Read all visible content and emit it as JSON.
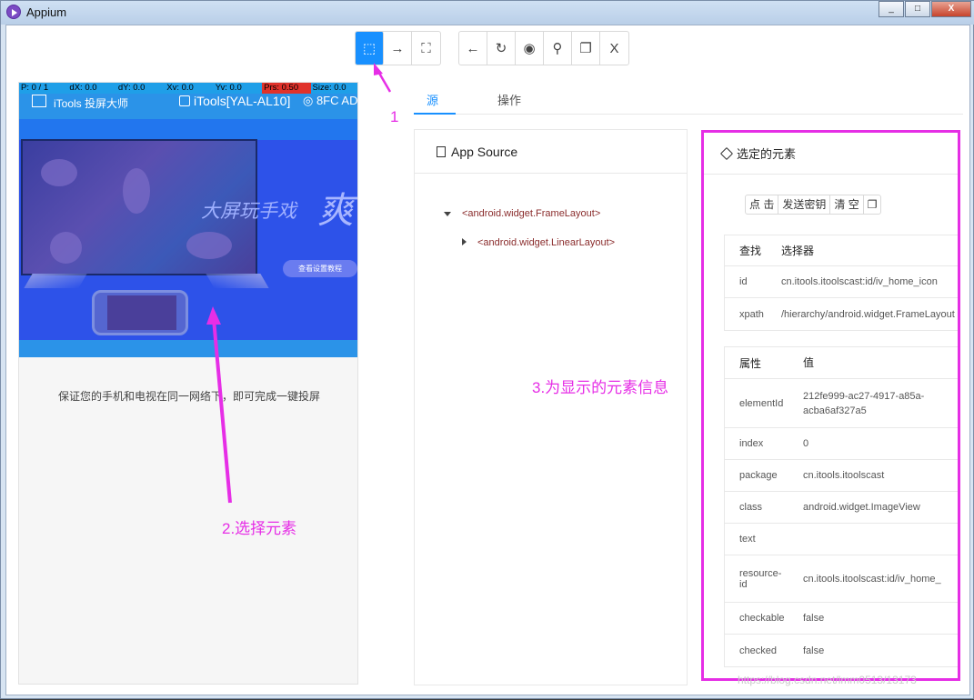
{
  "window": {
    "title": "Appium",
    "controls": [
      "_",
      "□",
      "X"
    ]
  },
  "toolbar": {
    "group1": [
      {
        "icon": "select-element-icon",
        "glyph": "⬚",
        "active": true
      },
      {
        "icon": "swipe-icon",
        "glyph": "→",
        "active": false
      },
      {
        "icon": "tap-coordinates-icon",
        "glyph": "⛶",
        "active": false
      }
    ],
    "group2": [
      {
        "icon": "back-icon",
        "glyph": "←"
      },
      {
        "icon": "refresh-icon",
        "glyph": "↻"
      },
      {
        "icon": "eye-icon",
        "glyph": "◉"
      },
      {
        "icon": "search-icon",
        "glyph": "⚲"
      },
      {
        "icon": "copy-icon",
        "glyph": "❐"
      },
      {
        "icon": "close-icon",
        "glyph": "X"
      }
    ]
  },
  "device": {
    "overlay": [
      "P: 0 / 1",
      "dX: 0.0",
      "dY: 0.0",
      "Xv: 0.0",
      "Yv: 0.0",
      "Prs: 0.50",
      "Size: 0.0"
    ],
    "header_left": "iTools 投屏大师",
    "header_right": "iTools[YAL-AL10]",
    "header_extra": "◎ 8FC AD",
    "slogan": "大屏玩手戏",
    "slogan_big": "爽",
    "tutorial_button": "查看设置教程",
    "caption": "保证您的手机和电视在同一网络下，即可完成一键投屏"
  },
  "annotations": {
    "step1": "1",
    "step2": "2.选择元素",
    "step3": "3.为显示的元素信息"
  },
  "tabs": {
    "source": "源",
    "actions": "操作"
  },
  "source_panel": {
    "title": "App Source",
    "tree": [
      {
        "label": "<android.widget.FrameLayout>",
        "expanded": true
      },
      {
        "label": "<android.widget.LinearLayout>",
        "expanded": false
      }
    ]
  },
  "selected_panel": {
    "title": "选定的元素",
    "actions": [
      "点 击",
      "发送密钥",
      "清 空",
      "❐"
    ],
    "find_header": [
      "查找",
      "选择器"
    ],
    "find_rows": [
      {
        "k": "id",
        "v": "cn.itools.itoolscast:id/iv_home_icon"
      },
      {
        "k": "xpath",
        "v": "/hierarchy/android.widget.FrameLayout"
      }
    ],
    "attr_header": [
      "属性",
      "值"
    ],
    "attr_rows": [
      {
        "k": "elementId",
        "v": "212fe999-ac27-4917-a85a-acba6af327a5"
      },
      {
        "k": "index",
        "v": "0"
      },
      {
        "k": "package",
        "v": "cn.itools.itoolscast"
      },
      {
        "k": "class",
        "v": "android.widget.ImageView"
      },
      {
        "k": "text",
        "v": ""
      },
      {
        "k": "resource-id",
        "v": "cn.itools.itoolscast:id/iv_home_"
      },
      {
        "k": "checkable",
        "v": "false"
      },
      {
        "k": "checked",
        "v": "false"
      }
    ]
  },
  "watermark": "https://blog.csdn.net/lmm0513/13173"
}
